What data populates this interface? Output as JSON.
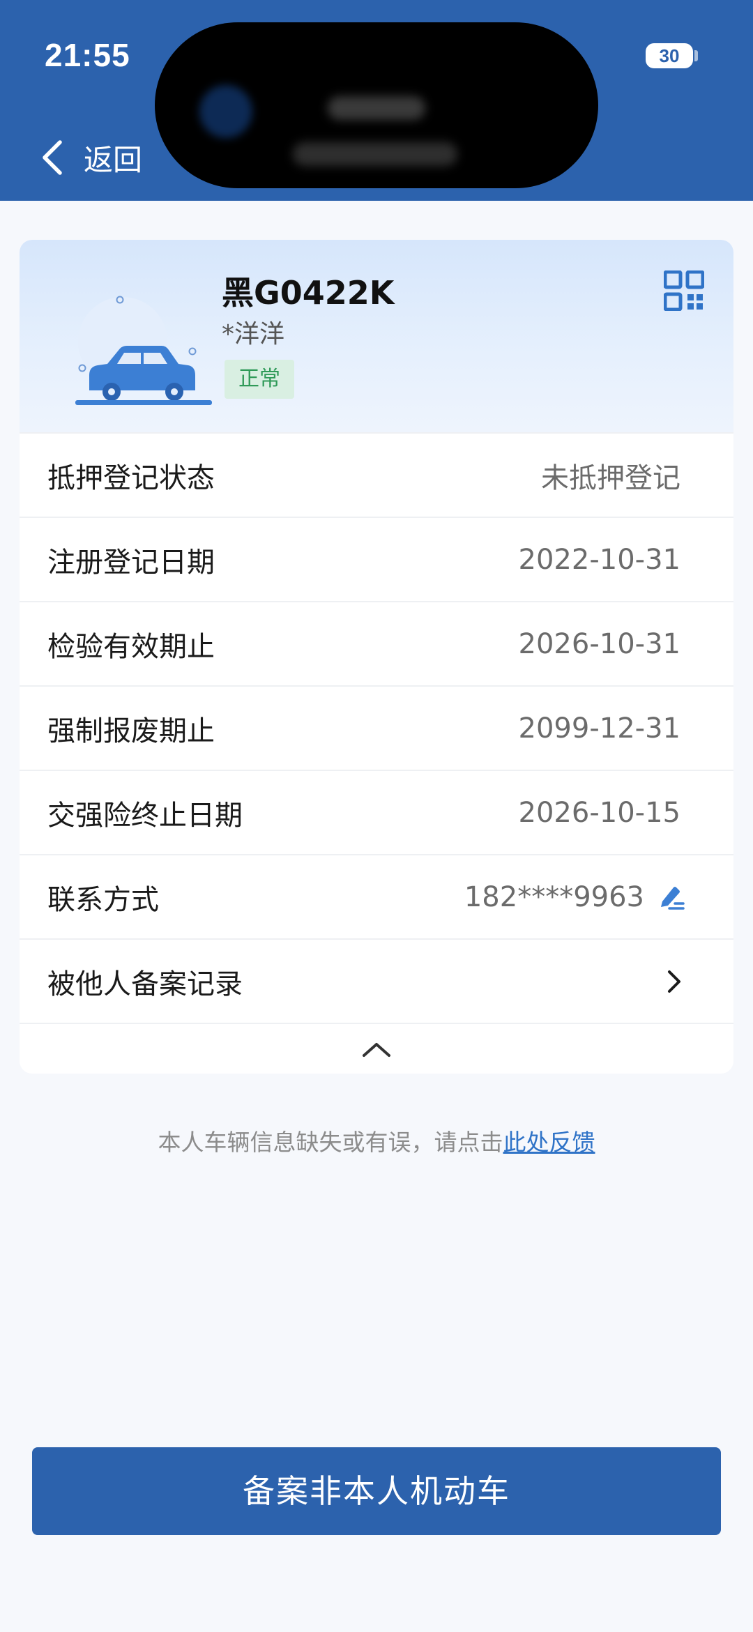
{
  "status_bar": {
    "time": "21:55",
    "battery": "30"
  },
  "nav": {
    "back_label": "返回"
  },
  "vehicle": {
    "plate": "黑G0422K",
    "owner": "*洋洋",
    "status": "正常"
  },
  "details": [
    {
      "label": "抵押登记状态",
      "value": "未抵押登记"
    },
    {
      "label": "注册登记日期",
      "value": "2022-10-31"
    },
    {
      "label": "检验有效期止",
      "value": "2026-10-31"
    },
    {
      "label": "强制报废期止",
      "value": "2099-12-31"
    },
    {
      "label": "交强险终止日期",
      "value": "2026-10-15"
    },
    {
      "label": "联系方式",
      "value": "182****9963"
    },
    {
      "label": "被他人备案记录",
      "value": ""
    }
  ],
  "feedback": {
    "text": "本人车辆信息缺失或有误，请点击",
    "link": "此处反馈"
  },
  "primary_button": {
    "label": "备案非本人机动车"
  },
  "colors": {
    "brand_blue": "#2c62ad",
    "badge_green": "#2f9a58",
    "link_blue": "#2f73c7"
  },
  "icons": {
    "back": "chevron-left-icon",
    "qr": "qr-code-icon",
    "edit": "edit-icon",
    "arrow": "chevron-right-icon",
    "collapse": "chevron-up-icon"
  }
}
